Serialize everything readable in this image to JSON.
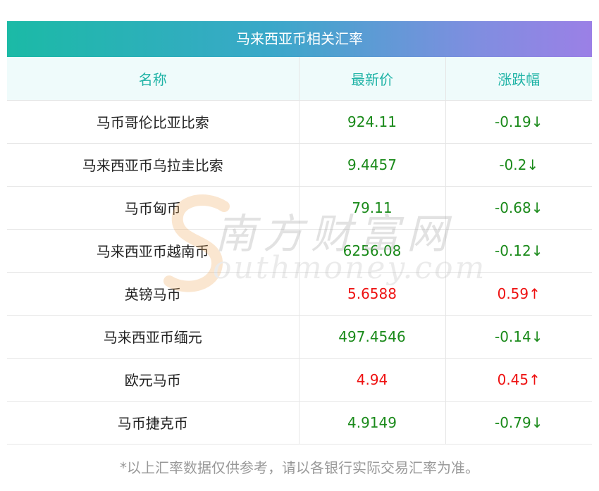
{
  "title": "马来西亚币相关汇率",
  "headers": [
    "名称",
    "最新价",
    "涨跌幅"
  ],
  "rows": [
    {
      "name": "马币哥伦比亚比索",
      "price": "924.11",
      "change": "-0.19↓",
      "trend": "down"
    },
    {
      "name": "马来西亚币乌拉圭比索",
      "price": "9.4457",
      "change": "-0.2↓",
      "trend": "down"
    },
    {
      "name": "马币匈币",
      "price": "79.11",
      "change": "-0.68↓",
      "trend": "down"
    },
    {
      "name": "马来西亚币越南币",
      "price": "6256.08",
      "change": "-0.12↓",
      "trend": "down"
    },
    {
      "name": "英镑马币",
      "price": "5.6588",
      "change": "0.59↑",
      "trend": "up"
    },
    {
      "name": "马来西亚币缅元",
      "price": "497.4546",
      "change": "-0.14↓",
      "trend": "down"
    },
    {
      "name": "欧元马币",
      "price": "4.94",
      "change": "0.45↑",
      "trend": "up"
    },
    {
      "name": "马币捷克币",
      "price": "4.9149",
      "change": "-0.79↓",
      "trend": "down"
    }
  ],
  "footnote": "*以上汇率数据仅供参考，请以各银行实际交易汇率为准。",
  "watermark": {
    "cn": "南方财富网",
    "en": "outhmoney.com"
  },
  "colors": {
    "up": "#ee1111",
    "down": "#1a8a1a",
    "header_text": "#1fb3a6"
  }
}
